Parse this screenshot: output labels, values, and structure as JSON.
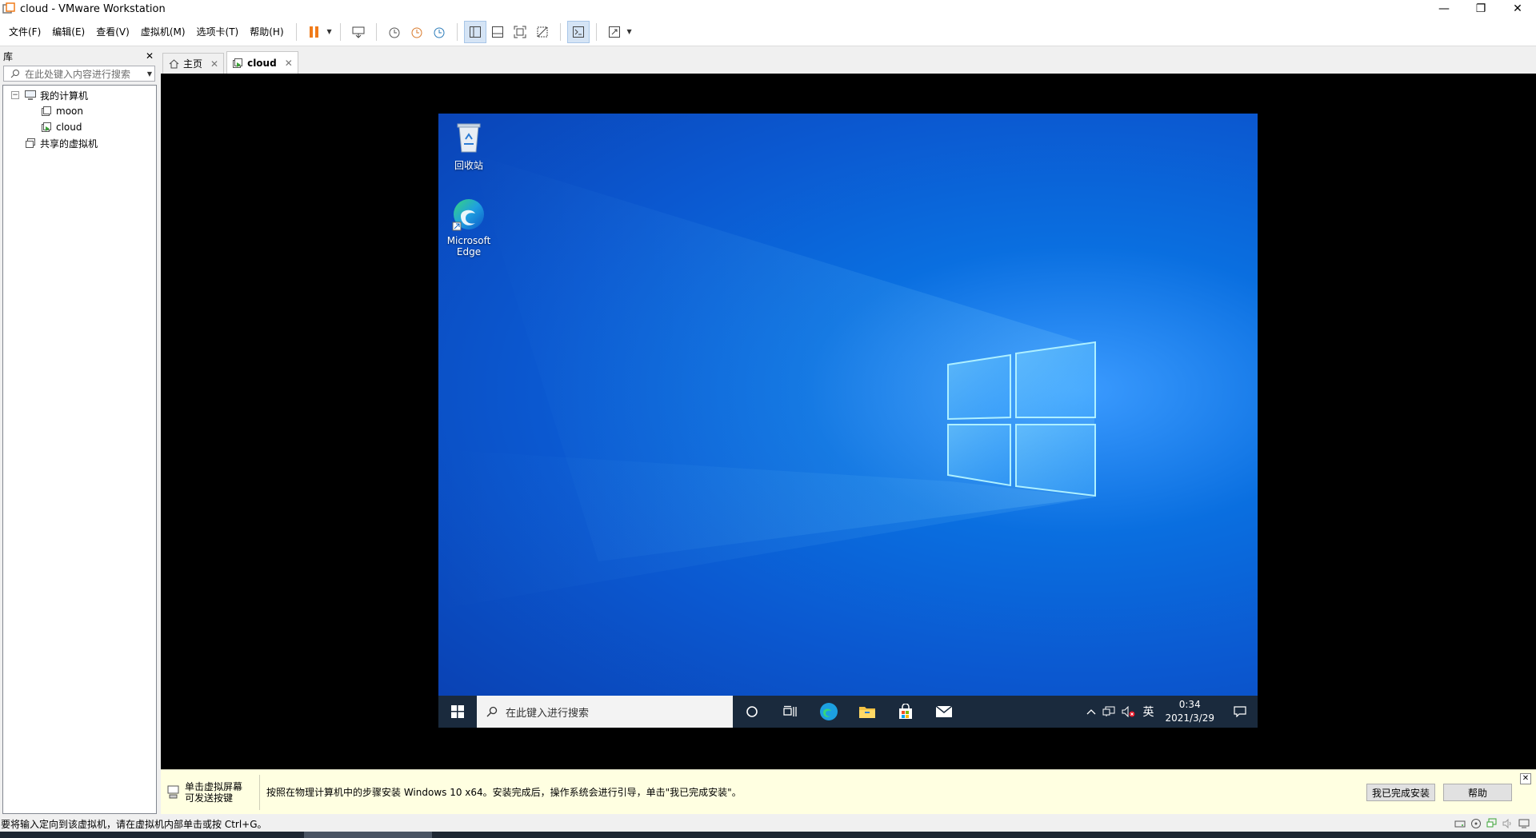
{
  "window": {
    "title": "cloud - VMware Workstation",
    "min": "—",
    "max": "❐",
    "close": "✕"
  },
  "menu": [
    {
      "label": "文件(F)"
    },
    {
      "label": "编辑(E)"
    },
    {
      "label": "查看(V)"
    },
    {
      "label": "虚拟机(M)"
    },
    {
      "label": "选项卡(T)"
    },
    {
      "label": "帮助(H)"
    }
  ],
  "library": {
    "title": "库",
    "close": "✕",
    "search_placeholder": "在此处键入内容进行搜索",
    "tree": {
      "root": "我的计算机",
      "vms": [
        "moon",
        "cloud"
      ],
      "shared": "共享的虚拟机"
    }
  },
  "tabs": [
    {
      "label": "主页",
      "close": "✕"
    },
    {
      "label": "cloud",
      "close": "✕"
    }
  ],
  "guest": {
    "icons": [
      {
        "label": "回收站"
      },
      {
        "label": "Microsoft Edge"
      }
    ],
    "taskbar": {
      "search_placeholder": "在此键入进行搜索",
      "ime": "英",
      "time": "0:34",
      "date": "2021/3/29"
    }
  },
  "hint": {
    "left_line1": "单击虚拟屏幕",
    "left_line2": "可发送按键",
    "message": "按照在物理计算机中的步骤安装 Windows 10 x64。安装完成后，操作系统会进行引导，单击\"我已完成安装\"。",
    "done_button": "我已完成安装",
    "help_button": "帮助",
    "close": "✕"
  },
  "status": {
    "text": "要将输入定向到该虚拟机，请在虚拟机内部单击或按 Ctrl+G。"
  },
  "colors": {
    "accent_orange": "#f07b1a",
    "desktop_blue": "#0b58d0",
    "taskbar": "#1a2a3d",
    "hint_bg": "#ffffe1"
  }
}
